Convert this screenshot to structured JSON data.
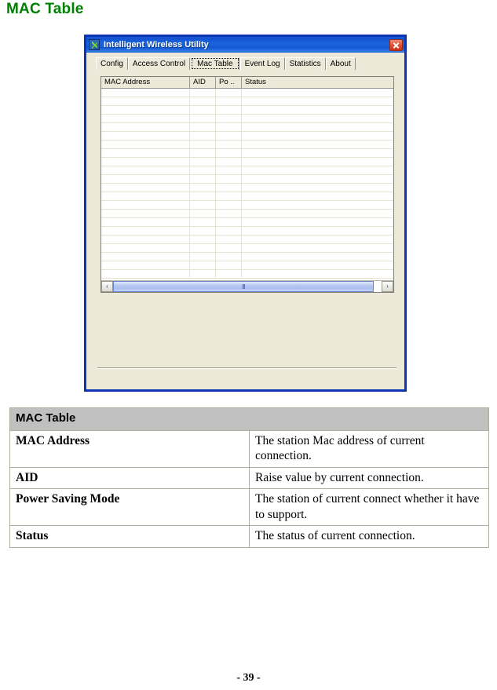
{
  "page": {
    "heading": "MAC Table",
    "footer": "- 39 -"
  },
  "app_window": {
    "title": "Intelligent Wireless Utility",
    "icon": "wireless-utility-icon",
    "close_label": "×",
    "tabs": [
      {
        "label": "Config",
        "selected": false
      },
      {
        "label": "Access Control",
        "selected": false
      },
      {
        "label": "Mac Table",
        "selected": true
      },
      {
        "label": "Event Log",
        "selected": false
      },
      {
        "label": "Statistics",
        "selected": false
      },
      {
        "label": "About",
        "selected": false
      }
    ],
    "listview": {
      "columns": [
        "MAC Address",
        "AID",
        "Po ..",
        "Status"
      ],
      "rows": [],
      "empty_row_count": 22,
      "scrollbar": {
        "left_arrow": "‹",
        "right_arrow": "›",
        "thumb_grip": "III"
      }
    }
  },
  "description_table": {
    "header": "MAC Table",
    "rows": [
      {
        "term": "MAC Address",
        "description": "The station Mac address of current connection."
      },
      {
        "term": "AID",
        "description": "Raise value by current connection."
      },
      {
        "term": "Power Saving Mode",
        "description": "The station of current connect whether it have to support."
      },
      {
        "term": "Status",
        "description": "The status of current connection."
      }
    ]
  },
  "colors": {
    "heading_green": "#008000",
    "title_bar_blue": "#1c64de",
    "window_border": "#0b35b5",
    "window_face": "#ece9d8",
    "close_red": "#c9351a",
    "table_header_gray": "#c0c0c0"
  }
}
